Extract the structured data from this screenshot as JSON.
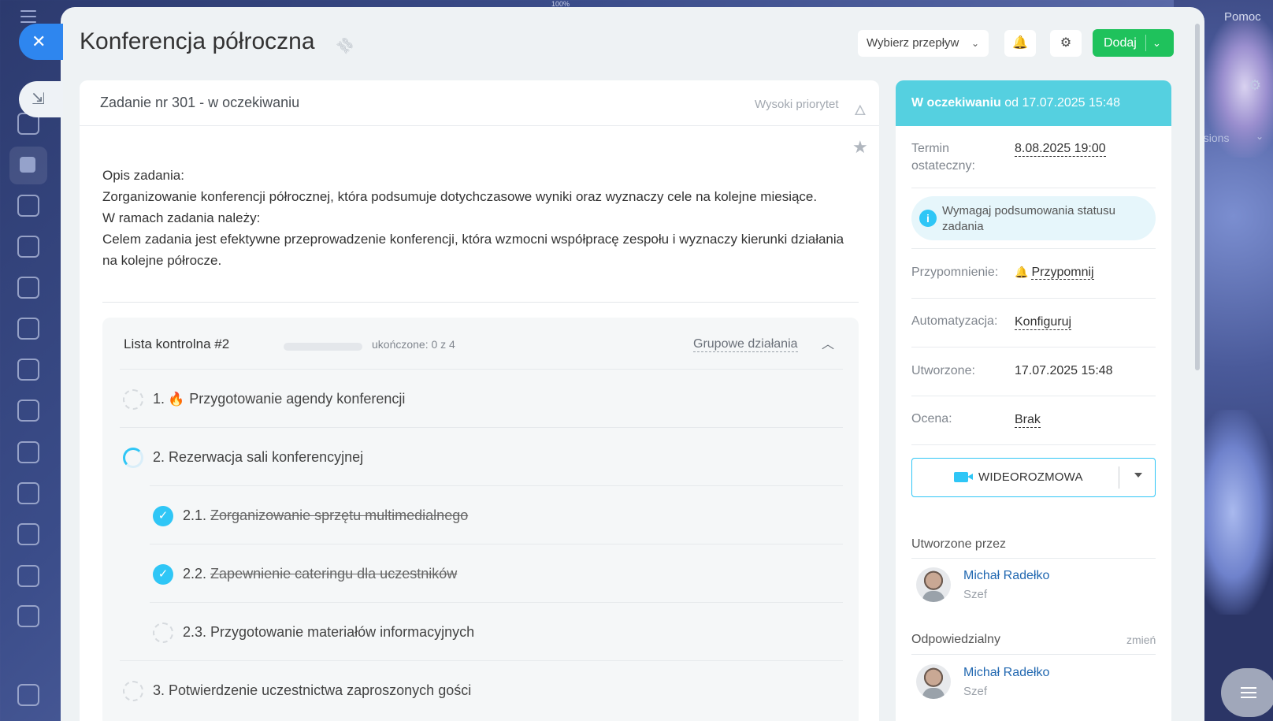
{
  "top_indicator": "100%",
  "help_label": "Pomoc",
  "bg_extension_text": "nsions",
  "header": {
    "title": "Konferencja półroczna",
    "flow_select": "Wybierz przepływ",
    "add_label": "Dodaj"
  },
  "task": {
    "number_status": "Zadanie nr 301 - w oczekiwaniu",
    "priority": "Wysoki priorytet",
    "description": [
      "Opis zadania:",
      "Zorganizowanie konferencji półrocznej, która podsumuje dotychczasowe wyniki oraz wyznaczy cele na kolejne miesiące.",
      "W ramach zadania należy:",
      "Celem zadania jest efektywne przeprowadzenie konferencji, która wzmocni współpracę zespołu i wyznaczy kierunki działania na kolejne półrocze."
    ]
  },
  "checklist": {
    "title": "Lista kontrolna #2",
    "progress": 0,
    "progress_text": "ukończone: 0 z 4",
    "group_actions": "Grupowe działania",
    "items": [
      {
        "num": "1.",
        "text": "Przygotowanie agendy konferencji",
        "state": "open",
        "important": true
      },
      {
        "num": "2.",
        "text": "Rezerwacja sali konferencyjnej",
        "state": "partial"
      },
      {
        "num": "2.1.",
        "text": "Zorganizowanie sprzętu multimedialnego",
        "state": "done"
      },
      {
        "num": "2.2.",
        "text": "Zapewnienie cateringu dla uczestników",
        "state": "done"
      },
      {
        "num": "2.3.",
        "text": "Przygotowanie materiałów informacyjnych",
        "state": "open"
      },
      {
        "num": "3.",
        "text": "Potwierdzenie uczestnictwa zaproszonych gości",
        "state": "open"
      }
    ]
  },
  "side": {
    "status_bold": "W oczekiwaniu",
    "status_rest": "od 17.07.2025 15:48",
    "deadline_label_1": "Termin",
    "deadline_label_2": "ostateczny:",
    "deadline_value": "8.08.2025 19:00",
    "info_text": "Wymagaj podsumowania statusu zadania",
    "reminder_label": "Przypomnienie:",
    "reminder_value": "Przypomnij",
    "automation_label": "Automatyzacja:",
    "automation_value": "Konfiguruj",
    "created_label": "Utworzone:",
    "created_value": "17.07.2025 15:48",
    "rating_label": "Ocena:",
    "rating_value": "Brak",
    "video_label": "WIDEOROZMOWA",
    "created_by_title": "Utworzone przez",
    "responsible_title": "Odpowiedzialny",
    "change_label": "zmień",
    "creator": {
      "name": "Michał Radełko",
      "role": "Szef"
    },
    "responsible": {
      "name": "Michał Radełko",
      "role": "Szef"
    }
  },
  "colors": {
    "accent": "#2fc6f6",
    "status_bar": "#55d0e0",
    "add_button": "#1fc25c",
    "close_button": "#2e86ef"
  }
}
